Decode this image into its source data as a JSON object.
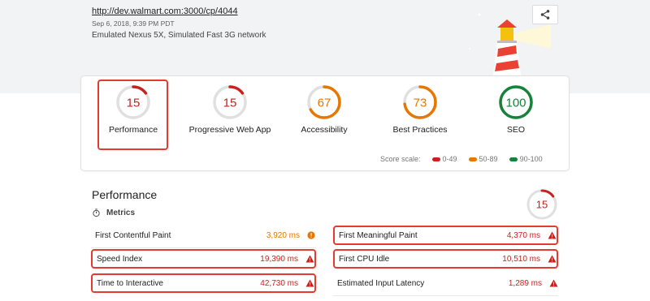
{
  "header": {
    "url": "http://dev.walmart.com:3000/cp/4044",
    "date": "Sep 6, 2018, 9:39 PM PDT",
    "environment": "Emulated Nexus 5X, Simulated Fast 3G network"
  },
  "gauges": [
    {
      "score": "15",
      "label": "Performance",
      "color": "#c7221f",
      "fraction": 0.15
    },
    {
      "score": "15",
      "label": "Progressive Web App",
      "color": "#c7221f",
      "fraction": 0.15
    },
    {
      "score": "67",
      "label": "Accessibility",
      "color": "#e67700",
      "fraction": 0.67
    },
    {
      "score": "73",
      "label": "Best Practices",
      "color": "#e67700",
      "fraction": 0.73
    },
    {
      "score": "100",
      "label": "SEO",
      "color": "#178239",
      "fraction": 1.0
    }
  ],
  "scale": {
    "label": "Score scale:",
    "items": [
      {
        "text": "0-49",
        "color": "#c7221f"
      },
      {
        "text": "50-89",
        "color": "#e67700"
      },
      {
        "text": "90-100",
        "color": "#178239"
      }
    ]
  },
  "performance": {
    "title": "Performance",
    "score": "15",
    "score_fraction": 0.15,
    "metrics_label": "Metrics",
    "metrics": [
      {
        "name": "First Contentful Paint",
        "value": "3,920 ms",
        "status": "average"
      },
      {
        "name": "First Meaningful Paint",
        "value": "4,370 ms",
        "status": "fail"
      },
      {
        "name": "Speed Index",
        "value": "19,390 ms",
        "status": "fail"
      },
      {
        "name": "First CPU Idle",
        "value": "10,510 ms",
        "status": "fail"
      },
      {
        "name": "Time to Interactive",
        "value": "42,730 ms",
        "status": "fail"
      },
      {
        "name": "Estimated Input Latency",
        "value": "1,289 ms",
        "status": "fail"
      }
    ]
  }
}
